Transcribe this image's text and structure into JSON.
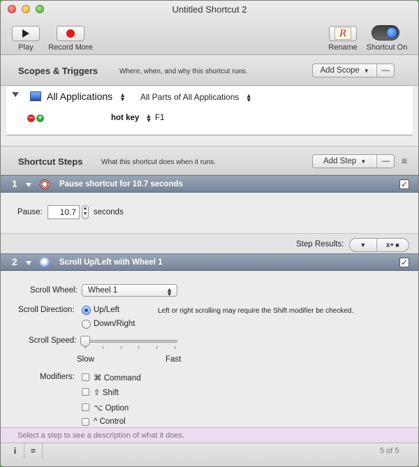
{
  "window": {
    "title": "Untitled Shortcut 2"
  },
  "toolbar": {
    "play_label": "Play",
    "record_label": "Record More",
    "rename_label": "Rename",
    "rename_glyph": "R",
    "shortcut_on_label": "Shortcut On"
  },
  "scopes": {
    "title": "Scopes & Triggers",
    "subtitle": "Where, when, and why this shortcut runs.",
    "add_scope_label": "Add Scope",
    "remove_label": "—",
    "app_scope": "All Applications",
    "parts_scope": "All Parts of All Applications",
    "trigger_type": "hot key",
    "trigger_key": "F1"
  },
  "steps": {
    "title": "Shortcut Steps",
    "subtitle": "What this shortcut does when it runs.",
    "add_step_label": "Add Step",
    "remove_label": "—",
    "menu_glyph": "≡",
    "items": [
      {
        "number": "1",
        "title": "Pause shortcut for 10.7 seconds",
        "pause_label": "Pause:",
        "pause_value": "10.7",
        "pause_unit": "seconds",
        "results_label": "Step Results:",
        "results_var": "x+"
      },
      {
        "number": "2",
        "title": "Scroll Up/Left with Wheel 1",
        "wheel_label": "Scroll Wheel:",
        "wheel_value": "Wheel 1",
        "direction_label": "Scroll Direction:",
        "direction_options": [
          "Up/Left",
          "Down/Right"
        ],
        "direction_note": "Left or right scrolling may require the Shift modifier be checked.",
        "speed_label": "Scroll Speed:",
        "speed_min": "Slow",
        "speed_max": "Fast",
        "modifiers_label": "Modifiers:",
        "modifiers": [
          "⌘ Command",
          "⇧ Shift",
          "⌥ Option",
          "^ Control"
        ]
      }
    ]
  },
  "status": {
    "description": "Select a step to see a description of what it does.",
    "info_glyph": "i",
    "list_glyph": "=",
    "count": "5 of 5"
  },
  "colors": {
    "step_bar": "#8592a8",
    "record": "#e21a1a",
    "description_bg": "#ecdcef"
  }
}
